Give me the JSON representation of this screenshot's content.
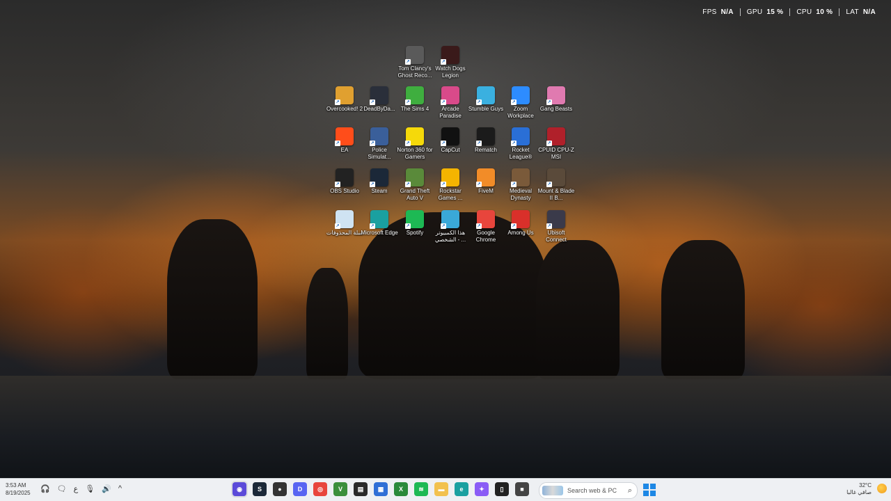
{
  "perf_overlay": [
    {
      "label": "FPS",
      "value": "N/A"
    },
    {
      "label": "GPU",
      "value": "15 %"
    },
    {
      "label": "CPU",
      "value": "10 %"
    },
    {
      "label": "LAT",
      "value": "N/A"
    }
  ],
  "desktop_icons": [
    {
      "label": "Tom Clancy's Ghost Reco...",
      "icon": "ghost-recon-icon",
      "color": "#5a5a5a"
    },
    {
      "label": "Watch Dogs Legion",
      "icon": "watch-dogs-icon",
      "color": "#3a1a1a"
    },
    {
      "label": "Overcooked! 2",
      "icon": "overcooked-icon",
      "color": "#e0a030"
    },
    {
      "label": "DeadByDa...",
      "icon": "dead-by-daylight-icon",
      "color": "#2a2f3a"
    },
    {
      "label": "The Sims 4",
      "icon": "sims-icon",
      "color": "#3fae3f"
    },
    {
      "label": "Arcade Paradise",
      "icon": "arcade-paradise-icon",
      "color": "#d94a8a"
    },
    {
      "label": "Stumble Guys",
      "icon": "stumble-guys-icon",
      "color": "#3ab0e0"
    },
    {
      "label": "Zoom Workplace",
      "icon": "zoom-icon",
      "color": "#2d8cff"
    },
    {
      "label": "Gang Beasts",
      "icon": "gang-beasts-icon",
      "color": "#e07ab0"
    },
    {
      "label": "EA",
      "icon": "ea-icon",
      "color": "#ff4d1a"
    },
    {
      "label": "Police Simulat...",
      "icon": "police-simulator-icon",
      "color": "#3a5f9a"
    },
    {
      "label": "Norton 360 for Gamers",
      "icon": "norton-icon",
      "color": "#f5d90a"
    },
    {
      "label": "CapCut",
      "icon": "capcut-icon",
      "color": "#111111"
    },
    {
      "label": "Rematch",
      "icon": "rematch-icon",
      "color": "#1b1b1b"
    },
    {
      "label": "Rocket League®",
      "icon": "rocket-league-icon",
      "color": "#2a6fd6"
    },
    {
      "label": "CPUID CPU-Z MSI",
      "icon": "cpuz-icon",
      "color": "#b0202a"
    },
    {
      "label": "OBS Studio",
      "icon": "obs-icon",
      "color": "#222222"
    },
    {
      "label": "Steam",
      "icon": "steam-icon",
      "color": "#1b2838"
    },
    {
      "label": "Grand Theft Auto V",
      "icon": "gta-icon",
      "color": "#5a8a3a"
    },
    {
      "label": "Rockstar Games ...",
      "icon": "rockstar-icon",
      "color": "#f4b400"
    },
    {
      "label": "FiveM",
      "icon": "fivem-icon",
      "color": "#f28c28"
    },
    {
      "label": "Medieval Dynasty",
      "icon": "medieval-dynasty-icon",
      "color": "#7a5a3a"
    },
    {
      "label": "Mount & Blade II B...",
      "icon": "mount-blade-icon",
      "color": "#5a4a3a"
    },
    {
      "label": "سلة المحذوفات",
      "icon": "recycle-bin-icon",
      "color": "#cfe3f2"
    },
    {
      "label": "Microsoft Edge",
      "icon": "edge-icon",
      "color": "#1aa0a0"
    },
    {
      "label": "Spotify",
      "icon": "spotify-icon",
      "color": "#1db954"
    },
    {
      "label": "هذا الكمبيوتر الشخصي - ...",
      "icon": "this-pc-icon",
      "color": "#3aa8d8"
    },
    {
      "label": "Google Chrome",
      "icon": "chrome-icon",
      "color": "#e8453c"
    },
    {
      "label": "Among Us",
      "icon": "among-us-icon",
      "color": "#d9302a"
    },
    {
      "label": "Ubisoft Connect",
      "icon": "ubisoft-icon",
      "color": "#3a3a4a"
    }
  ],
  "taskbar": {
    "time": "3:53 AM",
    "date": "8/19/2025",
    "tray_left": [
      "🎧",
      "🗨",
      "ع",
      "🎙",
      "🔊",
      "^"
    ],
    "apps": [
      {
        "icon": "discord-overlay-icon",
        "glyph": "◉",
        "color": "#5b4ad9"
      },
      {
        "icon": "steam-taskbar-icon",
        "glyph": "S",
        "color": "#1b2838"
      },
      {
        "icon": "app-red-icon",
        "glyph": "●",
        "color": "#333333"
      },
      {
        "icon": "discord-icon",
        "glyph": "D",
        "color": "#5865f2"
      },
      {
        "icon": "chrome-taskbar-icon",
        "glyph": "◎",
        "color": "#e8453c"
      },
      {
        "icon": "nvidia-icon",
        "glyph": "V",
        "color": "#3b8f3b"
      },
      {
        "icon": "notes-icon",
        "glyph": "▤",
        "color": "#2a2a2a"
      },
      {
        "icon": "store-icon",
        "glyph": "▦",
        "color": "#2f6fd6"
      },
      {
        "icon": "xbox-icon",
        "glyph": "X",
        "color": "#2a8a3a"
      },
      {
        "icon": "spotify-taskbar-icon",
        "glyph": "≋",
        "color": "#1db954"
      },
      {
        "icon": "file-explorer-icon",
        "glyph": "▬",
        "color": "#f2c14e"
      },
      {
        "icon": "edge-taskbar-icon",
        "glyph": "e",
        "color": "#1aa0a0"
      },
      {
        "icon": "copilot-icon",
        "glyph": "✦",
        "color": "#8a5cf6"
      },
      {
        "icon": "terminal-icon",
        "glyph": "▯",
        "color": "#222222"
      },
      {
        "icon": "window-icon",
        "glyph": "■",
        "color": "#444444"
      }
    ],
    "search_placeholder": "Search web & PC",
    "weather_temp": "32°C",
    "weather_desc": "صافي غالبا"
  }
}
